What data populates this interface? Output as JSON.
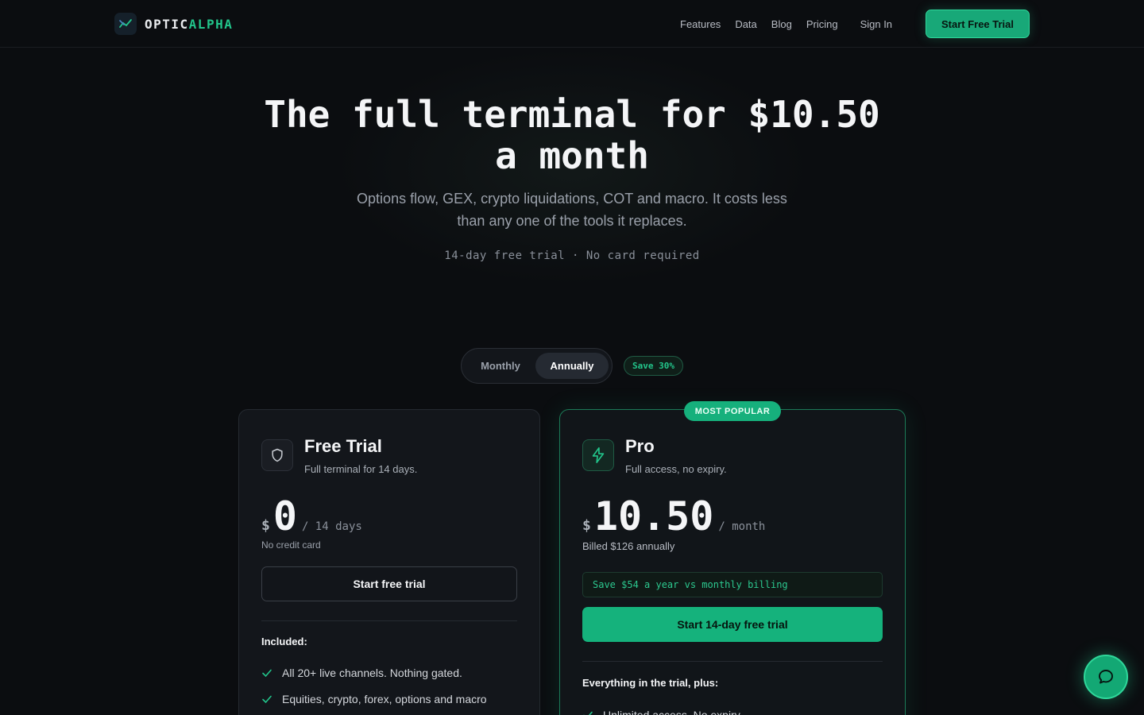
{
  "nav": {
    "brand_part1": "OPTIC",
    "brand_part2": "ALPHA",
    "links": [
      "Features",
      "Data",
      "Blog",
      "Pricing"
    ],
    "sign_in": "Sign In",
    "cta": "Start Free Trial"
  },
  "hero": {
    "title": "The full terminal for $10.50 a month",
    "subtitle": "Options flow, GEX, crypto liquidations, COT and macro. It costs less than any one of the tools it replaces.",
    "note": "14-day free trial · No card required"
  },
  "billing_toggle": {
    "options": [
      "Monthly",
      "Annually"
    ],
    "selected": "Annually",
    "save_badge": "Save 30%"
  },
  "plans": {
    "free": {
      "icon": "shield-icon",
      "name": "Free Trial",
      "description": "Full terminal for 14 days.",
      "currency": "$",
      "amount": "0",
      "period": "/ 14 days",
      "note": "No credit card",
      "button": "Start free trial",
      "features_heading": "Included:",
      "features": [
        "All 20+ live channels. Nothing gated.",
        "Equities, crypto, forex, options and macro"
      ]
    },
    "pro": {
      "badge": "MOST POPULAR",
      "icon": "lightning-icon",
      "name": "Pro",
      "description": "Full access, no expiry.",
      "currency": "$",
      "amount": "10.50",
      "period": "/ month",
      "note": "Billed $126 annually",
      "savings": "Save $54 a year vs monthly billing",
      "button": "Start 14-day free trial",
      "features_heading": "Everything in the trial, plus:",
      "features": [
        "Unlimited access. No expiry."
      ]
    }
  },
  "chat": {
    "icon": "chat-bubble-icon"
  },
  "colors": {
    "background": "#0b0d10",
    "accent": "#22c58b",
    "card": "#13161b"
  }
}
